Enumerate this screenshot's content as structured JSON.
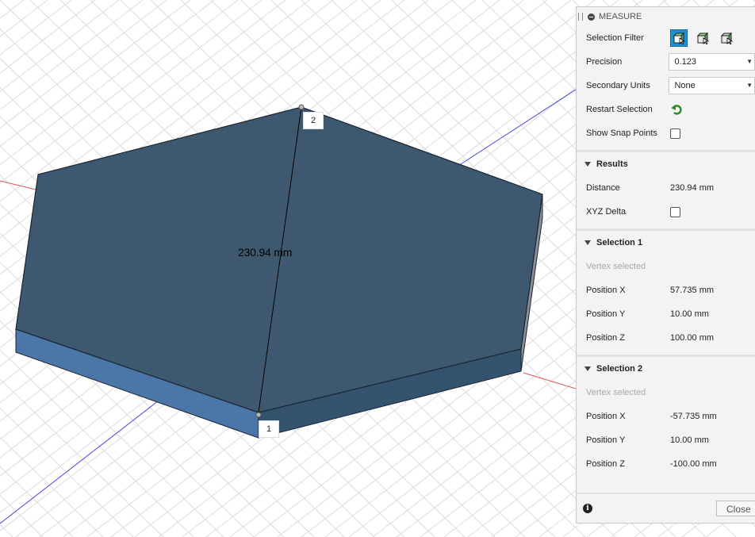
{
  "viewport": {
    "measurement_label": "230.94 mm",
    "point_1_label": "1",
    "point_2_label": "2"
  },
  "panel": {
    "title": "MEASURE",
    "selection_filter_label": "Selection Filter",
    "precision_label": "Precision",
    "precision_value": "0.123",
    "secondary_units_label": "Secondary Units",
    "secondary_units_value": "None",
    "restart_selection_label": "Restart Selection",
    "show_snap_points_label": "Show Snap Points",
    "results": {
      "header": "Results",
      "distance_label": "Distance",
      "distance_value": "230.94 mm",
      "xyz_delta_label": "XYZ Delta"
    },
    "selection1": {
      "header": "Selection 1",
      "status": "Vertex selected",
      "x_label": "Position X",
      "x_value": "57.735 mm",
      "y_label": "Position Y",
      "y_value": "10.00 mm",
      "z_label": "Position Z",
      "z_value": "100.00 mm"
    },
    "selection2": {
      "header": "Selection 2",
      "status": "Vertex selected",
      "x_label": "Position X",
      "x_value": "-57.735 mm",
      "y_label": "Position Y",
      "y_value": "10.00 mm",
      "z_label": "Position Z",
      "z_value": "-100.00 mm"
    },
    "close_label": "Close"
  },
  "colors": {
    "body_top": "#3e5870",
    "body_side": "#4a76a8",
    "active_filter": "#1f8fcf",
    "axis_x": "#e05555",
    "axis_z": "#4444dd"
  },
  "icons": {
    "filter_1": "vertex-filter-icon",
    "filter_2": "edge-filter-icon",
    "filter_3": "body-filter-icon",
    "restart": "restart-arrow-icon",
    "info": "info-icon"
  }
}
